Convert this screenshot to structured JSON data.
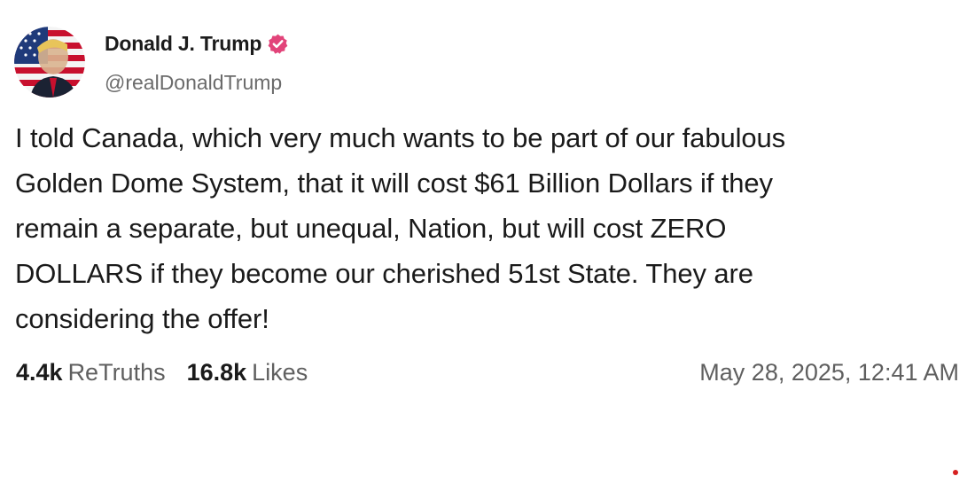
{
  "post": {
    "author": {
      "display_name": "Donald J. Trump",
      "handle": "@realDonaldTrump",
      "verified_icon": "verified-badge-icon",
      "verified_color": "#e2447a"
    },
    "body_lines": [
      "I told Canada, which very much wants to be part of our fabulous",
      "Golden Dome System, that it will cost $61 Billion Dollars if they",
      "remain a separate, but unequal, Nation, but will cost ZERO",
      "DOLLARS if they become our cherished 51st State. They are",
      "considering the offer!"
    ],
    "stats": {
      "retruths_count": "4.4k",
      "retruths_label": "ReTruths",
      "likes_count": "16.8k",
      "likes_label": "Likes"
    },
    "timestamp": "May 28, 2025, 12:41 AM"
  },
  "colors": {
    "background": "#ffffff",
    "text": "#1a1a1a",
    "muted": "#6b6b6b",
    "flag_red": "#c8102e",
    "flag_blue": "#1f3a7a"
  }
}
